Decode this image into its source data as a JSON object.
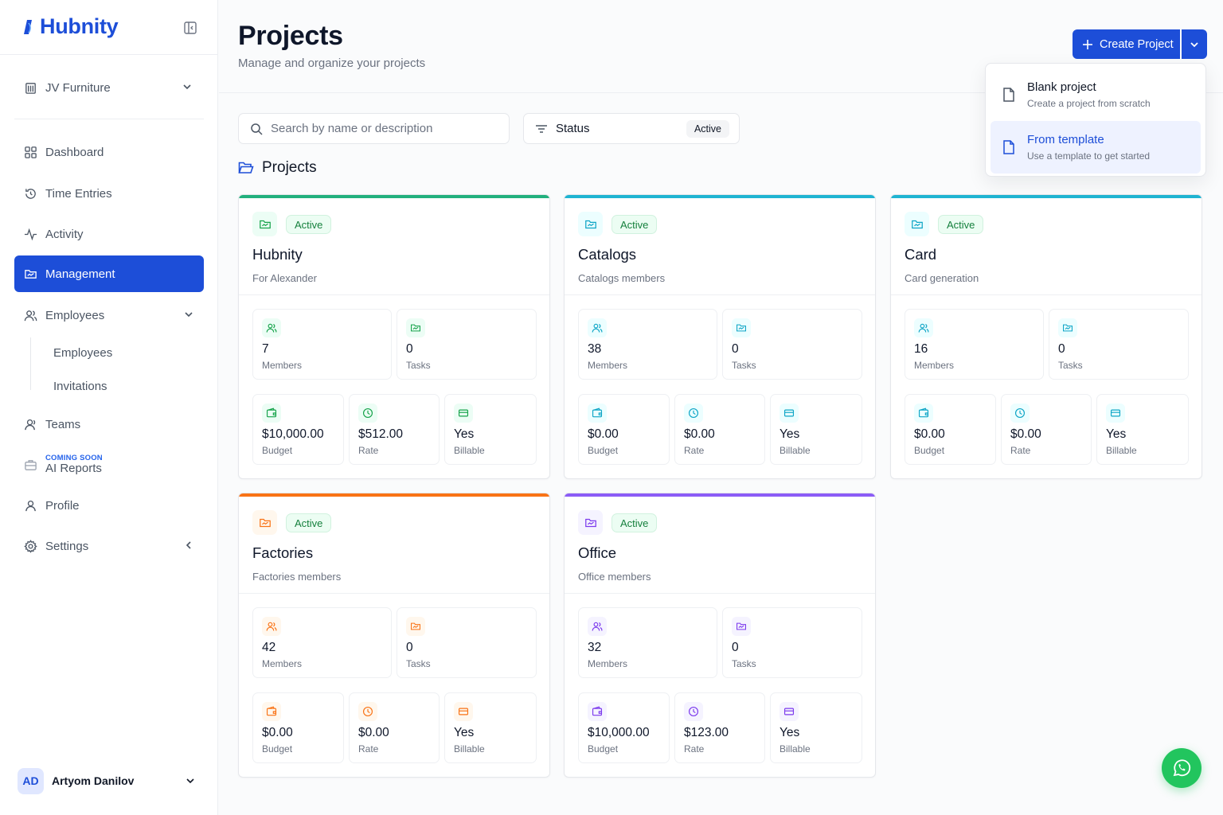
{
  "brand": {
    "name": "Hubnity"
  },
  "workspace": {
    "name": "JV Furniture"
  },
  "nav": {
    "dashboard": "Dashboard",
    "time_entries": "Time Entries",
    "activity": "Activity",
    "management": "Management",
    "employees": "Employees",
    "employees_sub": "Employees",
    "invitations": "Invitations",
    "teams": "Teams",
    "ai_reports_badge": "COMING SOON",
    "ai_reports": "AI Reports",
    "profile": "Profile",
    "settings": "Settings"
  },
  "user": {
    "initials": "AD",
    "name": "Artyom Danilov"
  },
  "header": {
    "title": "Projects",
    "subtitle": "Manage and organize your projects",
    "create_label": "Create Project"
  },
  "create_menu": {
    "items": [
      {
        "title": "Blank project",
        "desc": "Create a project from scratch"
      },
      {
        "title": "From template",
        "desc": "Use a template to get started"
      }
    ]
  },
  "filters": {
    "search_placeholder": "Search by name or description",
    "status_label": "Status",
    "status_value": "Active"
  },
  "section_title": "Projects",
  "projects": [
    {
      "name": "Hubnity",
      "desc": "For Alexander",
      "status": "Active",
      "accent": "#22b07d",
      "members": "7",
      "members_label": "Members",
      "tasks": "0",
      "tasks_label": "Tasks",
      "budget": "$10,000.00",
      "budget_label": "Budget",
      "rate": "$512.00",
      "rate_label": "Rate",
      "billable": "Yes",
      "billable_label": "Billable"
    },
    {
      "name": "Catalogs",
      "desc": "Catalogs members",
      "status": "Active",
      "accent": "#1fb4d2",
      "members": "38",
      "members_label": "Members",
      "tasks": "0",
      "tasks_label": "Tasks",
      "budget": "$0.00",
      "budget_label": "Budget",
      "rate": "$0.00",
      "rate_label": "Rate",
      "billable": "Yes",
      "billable_label": "Billable"
    },
    {
      "name": "Card",
      "desc": "Card generation",
      "status": "Active",
      "accent": "#1fb4d2",
      "members": "16",
      "members_label": "Members",
      "tasks": "0",
      "tasks_label": "Tasks",
      "budget": "$0.00",
      "budget_label": "Budget",
      "rate": "$0.00",
      "rate_label": "Rate",
      "billable": "Yes",
      "billable_label": "Billable"
    },
    {
      "name": "Factories",
      "desc": "Factories members",
      "status": "Active",
      "accent": "#f97316",
      "members": "42",
      "members_label": "Members",
      "tasks": "0",
      "tasks_label": "Tasks",
      "budget": "$0.00",
      "budget_label": "Budget",
      "rate": "$0.00",
      "rate_label": "Rate",
      "billable": "Yes",
      "billable_label": "Billable"
    },
    {
      "name": "Office",
      "desc": "Office members",
      "status": "Active",
      "accent": "#8b5cf6",
      "members": "32",
      "members_label": "Members",
      "tasks": "0",
      "tasks_label": "Tasks",
      "budget": "$10,000.00",
      "budget_label": "Budget",
      "rate": "$123.00",
      "rate_label": "Rate",
      "billable": "Yes",
      "billable_label": "Billable"
    }
  ],
  "icons": {
    "brand": "hubnity-logo-icon",
    "collapse": "sidebar-collapse-icon",
    "workspace": "building-icon",
    "dashboard": "grid-icon",
    "time_entries": "history-icon",
    "activity": "pulse-icon",
    "management": "folder-icon",
    "employees": "users-icon",
    "teams": "user-icon",
    "ai_reports": "briefcase-icon",
    "profile": "user-icon",
    "settings": "gear-icon",
    "chat": "whatsapp-icon"
  }
}
